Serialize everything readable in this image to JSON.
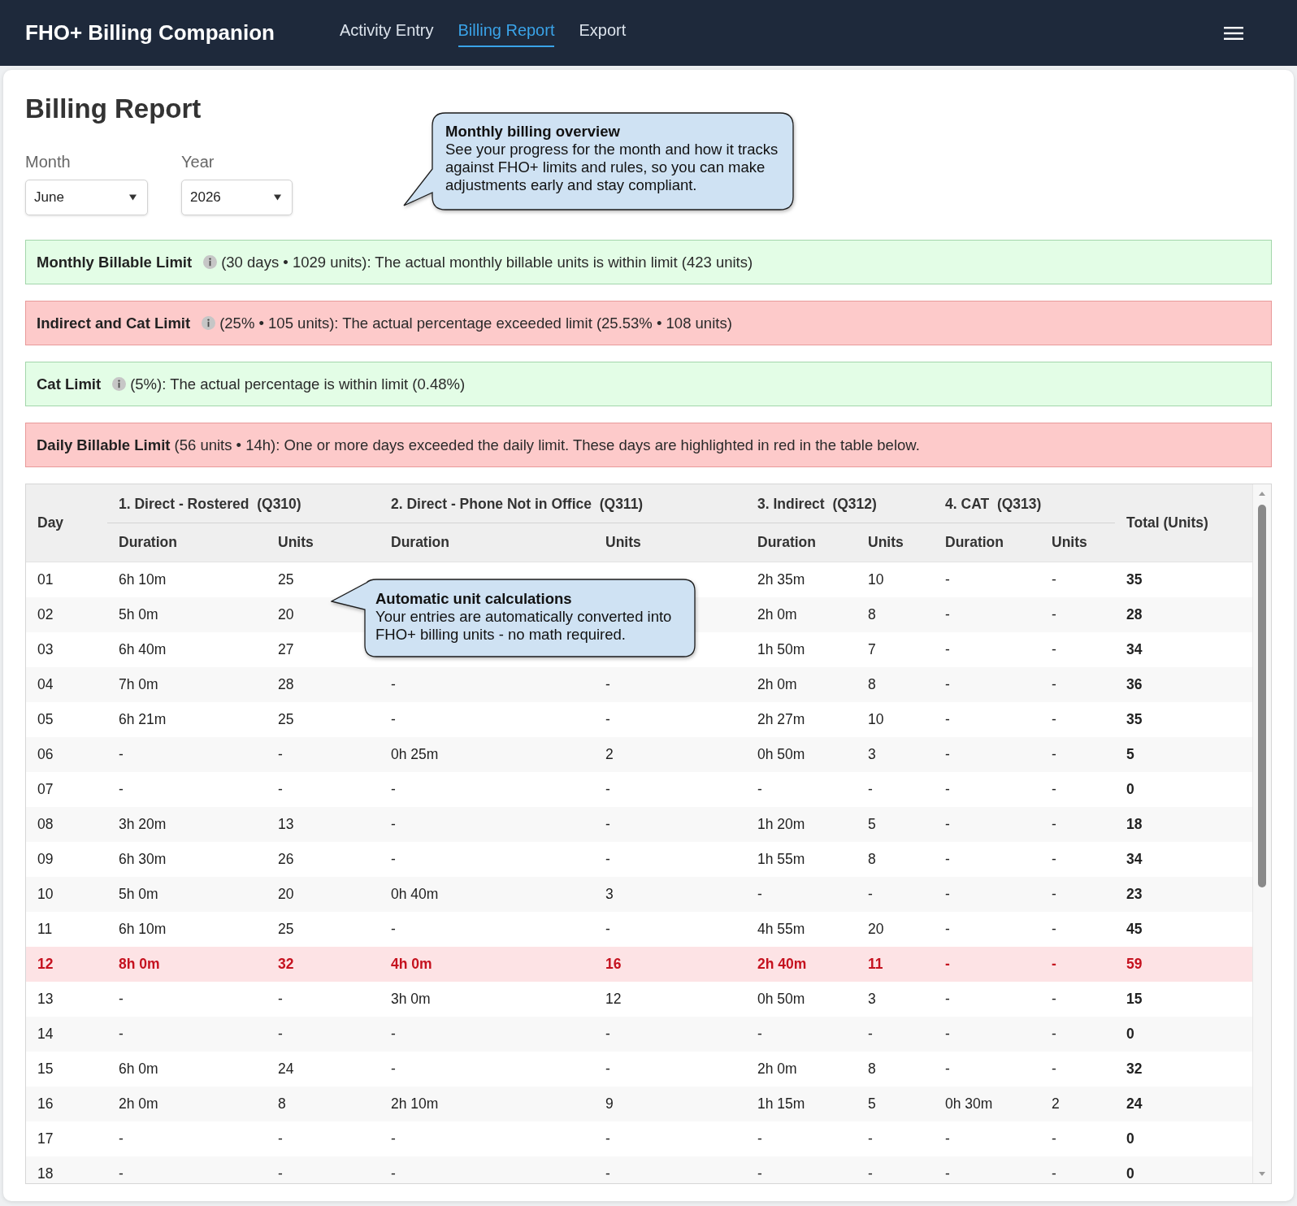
{
  "header": {
    "title": "FHO+ Billing Companion",
    "nav": [
      {
        "label": "Activity Entry",
        "selected": false
      },
      {
        "label": "Billing Report",
        "selected": true
      },
      {
        "label": "Export",
        "selected": false
      }
    ]
  },
  "page": {
    "title": "Billing Report",
    "filters": [
      {
        "label": "Month",
        "value": "June"
      },
      {
        "label": "Year",
        "value": "2026"
      }
    ]
  },
  "callouts": [
    {
      "title": "Monthly billing overview",
      "text": "See your progress for the month and how it tracks against FHO+ limits and rules, so you can make adjustments early and stay compliant."
    },
    {
      "title": "Automatic unit calculations",
      "text": "Your entries are automatically converted into FHO+ billing units - no math required."
    }
  ],
  "alerts": [
    {
      "title": "Monthly Billable Limit",
      "info": true,
      "text": "(30 days • 1029 units): The actual monthly billable units is within limit (423 units)",
      "exceeded": false
    },
    {
      "title": "Indirect and Cat Limit",
      "info": true,
      "text": "(25% • 105 units): The actual percentage exceeded limit (25.53% • 108 units)",
      "exceeded": true
    },
    {
      "title": "Cat Limit",
      "info": true,
      "text": "(5%): The actual percentage is within limit (0.48%)",
      "exceeded": false
    },
    {
      "title": "Daily Billable Limit",
      "info": false,
      "text": "(56 units • 14h): One or more days exceeded the daily limit. These days are highlighted in red in the table below.",
      "exceeded": true
    }
  ],
  "table": {
    "day_column": "Day",
    "groups": [
      {
        "label": "1. Direct - Rostered  (Q310)",
        "columns": [
          "Duration",
          "Units"
        ]
      },
      {
        "label": "2. Direct - Phone Not in Office  (Q311)",
        "columns": [
          "Duration",
          "Units"
        ]
      },
      {
        "label": "3. Indirect  (Q312)",
        "columns": [
          "Duration",
          "Units"
        ]
      },
      {
        "label": "4. CAT  (Q313)",
        "columns": [
          "Duration",
          "Units"
        ]
      }
    ],
    "total_column": "Total (Units)",
    "rows": [
      {
        "cells": [
          "01",
          "6h 10m",
          "25",
          null,
          null,
          "2h 35m",
          "10",
          "-",
          "-",
          "35"
        ],
        "exceeded": false
      },
      {
        "cells": [
          "02",
          "5h 0m",
          "20",
          null,
          null,
          "2h 0m",
          "8",
          "-",
          "-",
          "28"
        ],
        "exceeded": false
      },
      {
        "cells": [
          "03",
          "6h 40m",
          "27",
          null,
          null,
          "1h 50m",
          "7",
          "-",
          "-",
          "34"
        ],
        "exceeded": false
      },
      {
        "cells": [
          "04",
          "7h 0m",
          "28",
          "-",
          "-",
          "2h 0m",
          "8",
          "-",
          "-",
          "36"
        ],
        "exceeded": false
      },
      {
        "cells": [
          "05",
          "6h 21m",
          "25",
          "-",
          "-",
          "2h 27m",
          "10",
          "-",
          "-",
          "35"
        ],
        "exceeded": false
      },
      {
        "cells": [
          "06",
          "-",
          "-",
          "0h 25m",
          "2",
          "0h 50m",
          "3",
          "-",
          "-",
          "5"
        ],
        "exceeded": false
      },
      {
        "cells": [
          "07",
          "-",
          "-",
          "-",
          "-",
          "-",
          "-",
          "-",
          "-",
          "0"
        ],
        "exceeded": false
      },
      {
        "cells": [
          "08",
          "3h 20m",
          "13",
          "-",
          "-",
          "1h 20m",
          "5",
          "-",
          "-",
          "18"
        ],
        "exceeded": false
      },
      {
        "cells": [
          "09",
          "6h 30m",
          "26",
          "-",
          "-",
          "1h 55m",
          "8",
          "-",
          "-",
          "34"
        ],
        "exceeded": false
      },
      {
        "cells": [
          "10",
          "5h 0m",
          "20",
          "0h 40m",
          "3",
          "-",
          "-",
          "-",
          "-",
          "23"
        ],
        "exceeded": false
      },
      {
        "cells": [
          "11",
          "6h 10m",
          "25",
          "-",
          "-",
          "4h 55m",
          "20",
          "-",
          "-",
          "45"
        ],
        "exceeded": false
      },
      {
        "cells": [
          "12",
          "8h 0m",
          "32",
          "4h 0m",
          "16",
          "2h 40m",
          "11",
          "-",
          "-",
          "59"
        ],
        "exceeded": true
      },
      {
        "cells": [
          "13",
          "-",
          "-",
          "3h 0m",
          "12",
          "0h 50m",
          "3",
          "-",
          "-",
          "15"
        ],
        "exceeded": false
      },
      {
        "cells": [
          "14",
          "-",
          "-",
          "-",
          "-",
          "-",
          "-",
          "-",
          "-",
          "0"
        ],
        "exceeded": false
      },
      {
        "cells": [
          "15",
          "6h 0m",
          "24",
          "-",
          "-",
          "2h 0m",
          "8",
          "-",
          "-",
          "32"
        ],
        "exceeded": false
      },
      {
        "cells": [
          "16",
          "2h 0m",
          "8",
          "2h 10m",
          "9",
          "1h 15m",
          "5",
          "0h 30m",
          "2",
          "24"
        ],
        "exceeded": false
      },
      {
        "cells": [
          "17",
          "-",
          "-",
          "-",
          "-",
          "-",
          "-",
          "-",
          "-",
          "0"
        ],
        "exceeded": false
      },
      {
        "cells": [
          "18",
          "-",
          "-",
          "-",
          "-",
          "-",
          "-",
          "-",
          "-",
          "0"
        ],
        "exceeded": false
      }
    ]
  }
}
